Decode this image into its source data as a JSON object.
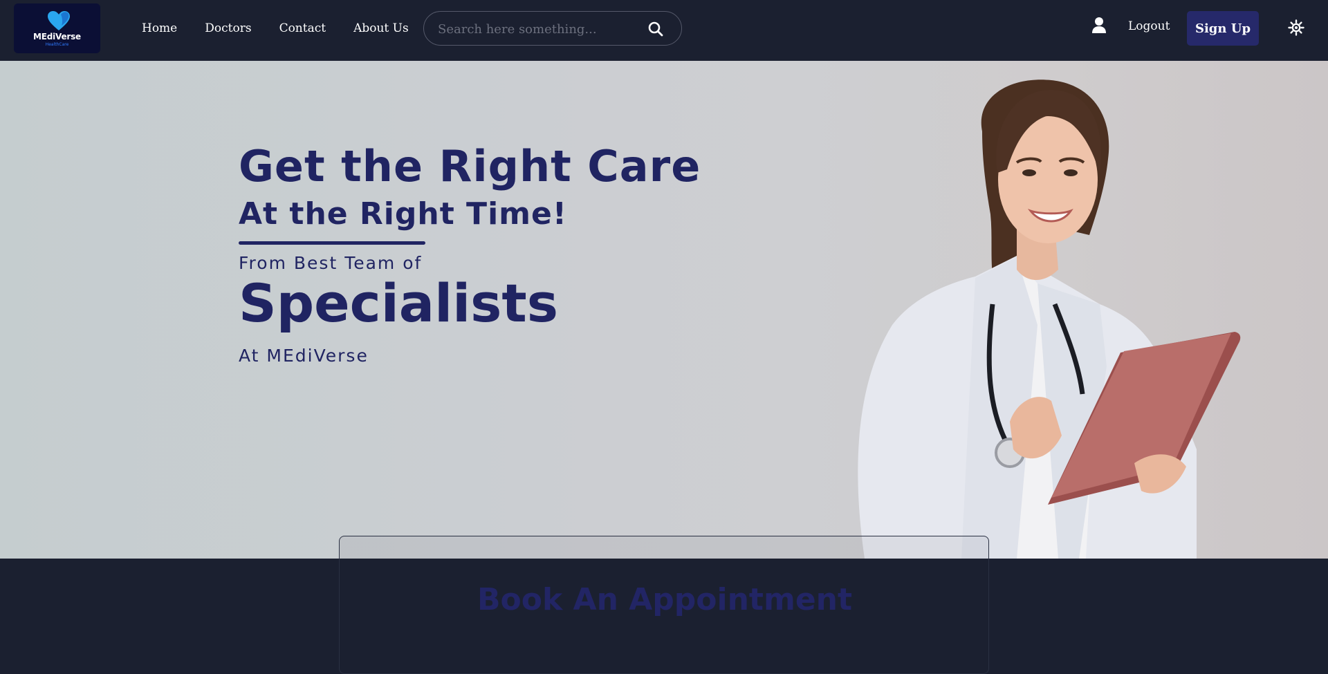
{
  "brand": {
    "name": "MEdiVerse",
    "tagline": "HealthCare",
    "heart_color": "#2aa6ef"
  },
  "nav": {
    "links": [
      {
        "label": "Home"
      },
      {
        "label": "Doctors"
      },
      {
        "label": "Contact"
      },
      {
        "label": "About Us"
      }
    ]
  },
  "search": {
    "placeholder": "Search here something...",
    "icon": "search-icon"
  },
  "account": {
    "user_icon": "user-icon",
    "logout_label": "Logout",
    "signup_label": "Sign Up",
    "theme_icon": "sun-icon"
  },
  "hero": {
    "line1": "Get the Right Care",
    "line2": "At the Right Time!",
    "line3": "From Best Team of",
    "line4": "Specialists",
    "line5": "At MEdiVerse",
    "image": "doctor-with-tablet"
  },
  "appointment": {
    "title": "Book An Appointment"
  },
  "colors": {
    "navbar": "#1b2030",
    "accent": "#26296a",
    "hero_text": "#202462"
  }
}
